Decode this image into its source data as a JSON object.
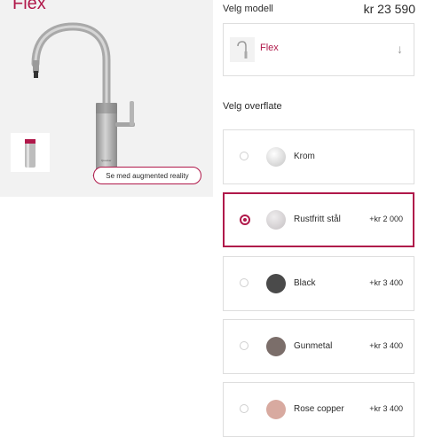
{
  "product": {
    "title": "Flex",
    "ar_button": "Se med augmented reality"
  },
  "config": {
    "model_label": "Velg modell",
    "price": "kr 23 590",
    "model_name": "Flex",
    "model_arrow": "↓",
    "finish_label": "Velg overflate",
    "finishes": [
      {
        "name": "Krom",
        "price": "",
        "color": "#e6e6e6",
        "selected": false
      },
      {
        "name": "Rustfritt stål",
        "price": "+kr 2 000",
        "color": "#d9d6d8",
        "selected": true
      },
      {
        "name": "Black",
        "price": "+kr 3 400",
        "color": "#4a4a4a",
        "selected": false
      },
      {
        "name": "Gunmetal",
        "price": "+kr 3 400",
        "color": "#7b6e6a",
        "selected": false
      },
      {
        "name": "Rose copper",
        "price": "+kr 3 400",
        "color": "#d8aaa0",
        "selected": false
      }
    ]
  },
  "colors": {
    "accent": "#b0184a"
  }
}
